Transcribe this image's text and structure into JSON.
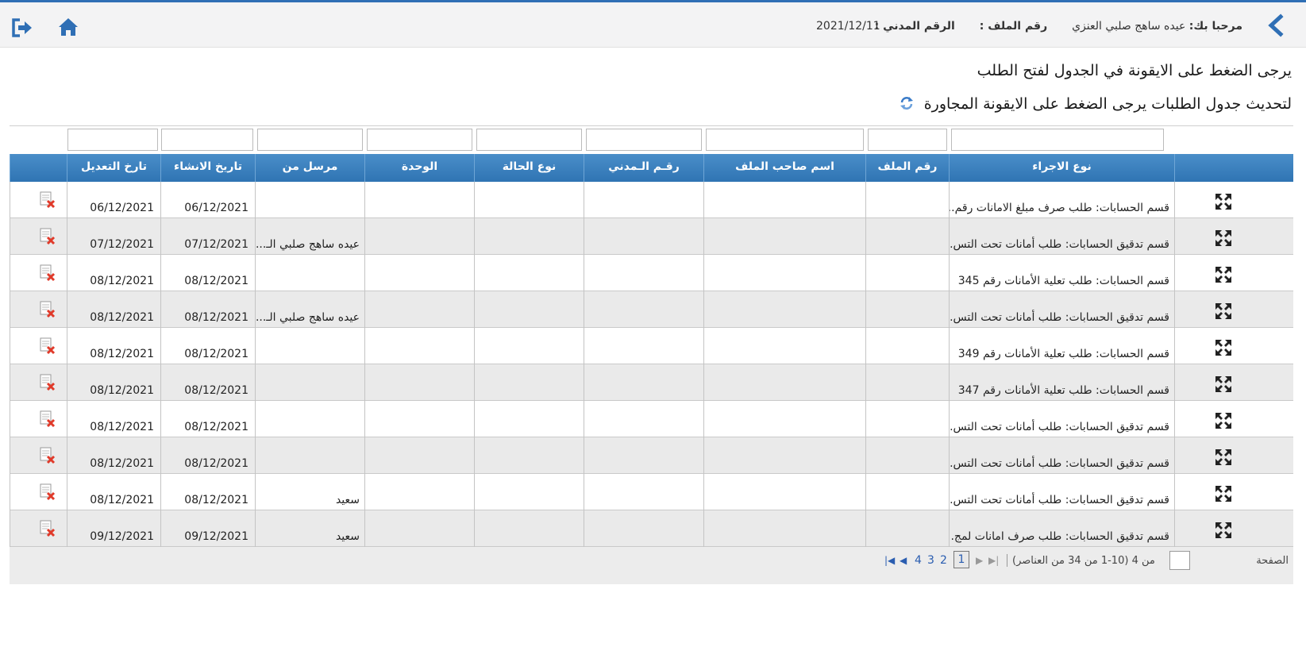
{
  "header": {
    "welcome_label": "مرحبا بك:",
    "user_name": "عيده ساهج صلبي العنزي",
    "file_no_label": "رقم الملف :",
    "civil_no_label": "الرقم المدني :",
    "date": "2021/12/11"
  },
  "messages": {
    "line1": "يرجى الضغط على الايقونة في الجدول لفتح الطلب",
    "line2": "لتحديث جدول الطلبات يرجى الضغط على الايقونة المجاورة"
  },
  "table": {
    "columns": [
      "نوع الاجراء",
      "رقم الملف",
      "اسم صاحب الملف",
      "رقـم الـمدني",
      "نوع الحالة",
      "الوحدة",
      "مرسل من",
      "تاريخ الانشاء",
      "تارخ التعديل"
    ],
    "rows": [
      {
        "action": "قسم الحسابات: طلب صرف مبلغ الامانات رقم...",
        "file_no": "",
        "owner": "",
        "civil": "",
        "status": "",
        "unit": "",
        "sender": "",
        "created": "06/12/2021",
        "modified": "06/12/2021"
      },
      {
        "action": "قسم تدقيق الحسابات: طلب أمانات تحت التس...",
        "file_no": "",
        "owner": "",
        "civil": "",
        "status": "",
        "unit": "",
        "sender": "عيده ساهج صلبي الـ...",
        "created": "07/12/2021",
        "modified": "07/12/2021"
      },
      {
        "action": "قسم الحسابات: طلب تعلية الأمانات رقم 345",
        "file_no": "",
        "owner": "",
        "civil": "",
        "status": "",
        "unit": "",
        "sender": "",
        "created": "08/12/2021",
        "modified": "08/12/2021"
      },
      {
        "action": "قسم تدقيق الحسابات: طلب أمانات تحت التس...",
        "file_no": "",
        "owner": "",
        "civil": "",
        "status": "",
        "unit": "",
        "sender": "عيده ساهج صلبي الـ...",
        "created": "08/12/2021",
        "modified": "08/12/2021"
      },
      {
        "action": "قسم الحسابات: طلب تعلية الأمانات رقم 349",
        "file_no": "",
        "owner": "",
        "civil": "",
        "status": "",
        "unit": "",
        "sender": "",
        "created": "08/12/2021",
        "modified": "08/12/2021"
      },
      {
        "action": "قسم الحسابات: طلب تعلية الأمانات رقم 347",
        "file_no": "",
        "owner": "",
        "civil": "",
        "status": "",
        "unit": "",
        "sender": "",
        "created": "08/12/2021",
        "modified": "08/12/2021"
      },
      {
        "action": "قسم تدقيق الحسابات: طلب أمانات تحت التس...",
        "file_no": "",
        "owner": "",
        "civil": "",
        "status": "",
        "unit": "",
        "sender": "",
        "created": "08/12/2021",
        "modified": "08/12/2021"
      },
      {
        "action": "قسم تدقيق الحسابات: طلب أمانات تحت التس...",
        "file_no": "",
        "owner": "",
        "civil": "",
        "status": "",
        "unit": "",
        "sender": "",
        "created": "08/12/2021",
        "modified": "08/12/2021"
      },
      {
        "action": "قسم تدقيق الحسابات: طلب أمانات تحت التس...",
        "file_no": "",
        "owner": "",
        "civil": "",
        "status": "",
        "unit": "",
        "sender": "سعيد",
        "created": "08/12/2021",
        "modified": "08/12/2021"
      },
      {
        "action": "قسم تدقيق الحسابات: طلب صرف امانات لمج...",
        "file_no": "",
        "owner": "",
        "civil": "",
        "status": "",
        "unit": "",
        "sender": "سعيد",
        "created": "09/12/2021",
        "modified": "09/12/2021"
      }
    ]
  },
  "pager": {
    "page_label": "الصفحة",
    "total_text": "من 4 (10-1 من 34 من العناصر)",
    "current_page": "1",
    "pages": [
      "2",
      "3",
      "4"
    ]
  },
  "icons": {
    "back": "chevron-left-icon",
    "home": "home-icon",
    "logout": "logout-icon",
    "refresh": "refresh-icon",
    "open": "expand-arrows-icon",
    "delete": "delete-document-icon"
  },
  "colors": {
    "header_band": "#2f74b3",
    "accent": "#2f6fb5"
  }
}
